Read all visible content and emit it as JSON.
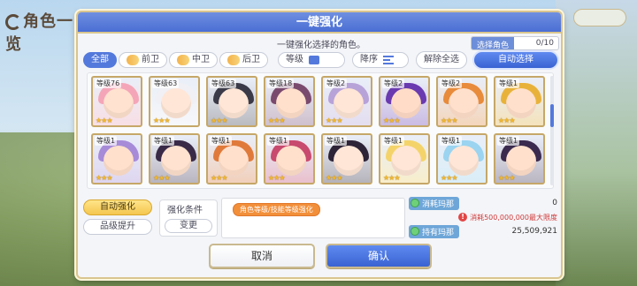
{
  "background": {
    "title": "角色一览"
  },
  "dialog": {
    "title": "一键强化",
    "subtitle": "一键强化选择的角色。",
    "select": {
      "label": "选择角色",
      "value": "0/10"
    }
  },
  "filters": {
    "tabs": [
      "全部",
      "前卫",
      "中卫",
      "后卫"
    ],
    "sort_level": "等级",
    "sort_order": "降序",
    "deselect_all": "解除全选",
    "auto_select": "自动选择"
  },
  "characters": [
    {
      "level": "等级76",
      "stars": "★★★",
      "hair": "#f4a6b8",
      "face": "#ffe2cf"
    },
    {
      "level": "等级63",
      "stars": "★★★",
      "hair": "#f0f0f5",
      "face": "#ffe6d6"
    },
    {
      "level": "等级63",
      "stars": "★★★",
      "hair": "#3a3a48",
      "face": "#ffe6d6"
    },
    {
      "level": "等级18",
      "stars": "★★★",
      "hair": "#7a4a6e",
      "face": "#ffe0cc"
    },
    {
      "level": "等级2",
      "stars": "★★★",
      "hair": "#b8a3d8",
      "face": "#ffe6d6"
    },
    {
      "level": "等级2",
      "stars": "★★★",
      "hair": "#6a3ab0",
      "face": "#ffdcc8"
    },
    {
      "level": "等级2",
      "stars": "★★★",
      "hair": "#e88b3a",
      "face": "#ffe0cc"
    },
    {
      "level": "等级1",
      "stars": "★★★",
      "hair": "#e8b23a",
      "face": "#ffe0cc"
    },
    {
      "level": "等级1",
      "stars": "★★★",
      "hair": "#a78bd8",
      "face": "#ffe0cc"
    },
    {
      "level": "等级1",
      "stars": "★★★",
      "hair": "#3a2a48",
      "face": "#ffe2cf"
    },
    {
      "level": "等级1",
      "stars": "★★★",
      "hair": "#e07a3a",
      "face": "#ffe0cc"
    },
    {
      "level": "等级1",
      "stars": "★★★",
      "hair": "#c84a6e",
      "face": "#ffe0cc"
    },
    {
      "level": "等级1",
      "stars": "★★★",
      "hair": "#2e2438",
      "face": "#ffe6d6"
    },
    {
      "level": "等级1",
      "stars": "★★★",
      "hair": "#f4d46a",
      "face": "#ffe6d6"
    },
    {
      "level": "等级1",
      "stars": "★★★",
      "hair": "#9ad4f0",
      "face": "#ffe6d6"
    },
    {
      "level": "等级1",
      "stars": "★★★",
      "hair": "#3a2a4e",
      "face": "#ffe0cc"
    }
  ],
  "bottom": {
    "auto_enhance": "自动强化",
    "rank_up": "品级提升",
    "condition_label": "强化条件",
    "change": "变更",
    "condition_tag": "角色等级/技能等级强化",
    "mana_cost_label": "消耗玛那",
    "mana_cost_value": "0",
    "mana_warning": "消耗500,000,000最大限度",
    "mana_owned_label": "持有玛那",
    "mana_owned_value": "25,509,921",
    "cancel": "取消",
    "confirm": "确认"
  }
}
